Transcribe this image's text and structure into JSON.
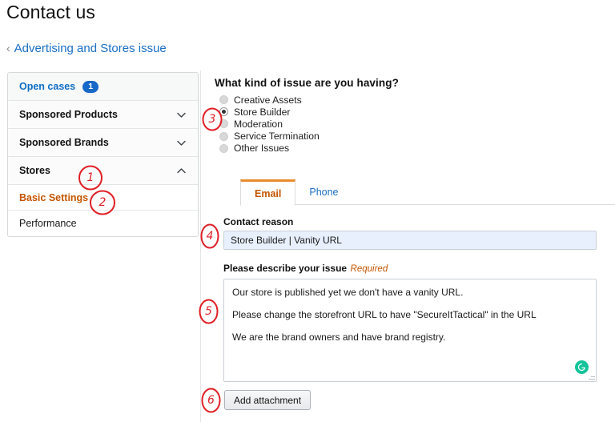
{
  "header": {
    "title": "Contact us",
    "breadcrumb_back_icon": "chevron-left-icon",
    "breadcrumb_label": "Advertising and Stores issue"
  },
  "sidebar": {
    "open_cases": {
      "label": "Open cases",
      "count": "1"
    },
    "groups": [
      {
        "label": "Sponsored Products",
        "icon": "chevron-down-icon",
        "expanded": false
      },
      {
        "label": "Sponsored Brands",
        "icon": "chevron-down-icon",
        "expanded": false
      },
      {
        "label": "Stores",
        "icon": "chevron-up-icon",
        "expanded": true
      }
    ],
    "sub_items": [
      {
        "label": "Basic Settings",
        "selected": true
      },
      {
        "label": "Performance",
        "selected": false
      }
    ]
  },
  "main": {
    "question": "What kind of issue are you having?",
    "options": [
      {
        "label": "Creative Assets",
        "checked": false
      },
      {
        "label": "Store Builder",
        "checked": true
      },
      {
        "label": "Moderation",
        "checked": false
      },
      {
        "label": "Service Termination",
        "checked": false
      },
      {
        "label": "Other Issues",
        "checked": false
      }
    ],
    "tabs": [
      {
        "label": "Email",
        "active": true
      },
      {
        "label": "Phone",
        "active": false
      }
    ],
    "contact_reason": {
      "label": "Contact reason",
      "value": "Store Builder | Vanity URL"
    },
    "describe": {
      "label": "Please describe your issue",
      "required_text": "Required",
      "lines": [
        "Our store is published yet we don't have a vanity URL.",
        "Please change the storefront URL to have \"SecureItTactical\" in the URL",
        "We are the brand owners and have brand registry."
      ],
      "assistant_icon": "grammarly-icon"
    },
    "add_attachment_label": "Add attachment"
  },
  "annotations": [
    {
      "id": "annot-1",
      "text": "1"
    },
    {
      "id": "annot-2",
      "text": "2"
    },
    {
      "id": "annot-3",
      "text": "3"
    },
    {
      "id": "annot-4",
      "text": "4"
    },
    {
      "id": "annot-5",
      "text": "5"
    },
    {
      "id": "annot-6",
      "text": "6"
    }
  ],
  "colors": {
    "link_blue": "#1a6fc4",
    "accent_orange": "#C45500",
    "tab_top_orange": "#E98B2D",
    "badge_blue": "#1768c9",
    "annotation_red": "#E01F26",
    "autofill_blue": "#E8F0FE",
    "grammarly_green": "#15C39A"
  }
}
